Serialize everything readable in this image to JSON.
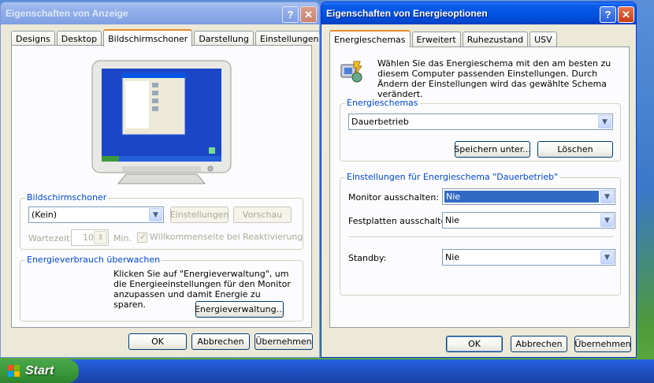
{
  "display_window": {
    "title": "Eigenschaften von Anzeige",
    "help_btn": "?",
    "close_btn": "✕",
    "tabs": [
      "Designs",
      "Desktop",
      "Bildschirmschoner",
      "Darstellung",
      "Einstellungen"
    ],
    "selected_tab": "Bildschirmschoner",
    "screensaver_group": {
      "label": "Bildschirmschoner",
      "selected": "(Kein)",
      "settings_btn": "Einstellungen",
      "preview_btn": "Vorschau",
      "wait_label": "Wartezeit:",
      "wait_value": "10",
      "min_label": "Min.",
      "welcome_label": "Willkommenseite bei Reaktivierung"
    },
    "energy_group": {
      "label": "Energieverbrauch überwachen",
      "description": "Klicken Sie auf \"Energieverwaltung\", um die Energieeinstellungen für den Monitor anzupassen und damit Energie zu sparen.",
      "button": "Energieverwaltung..."
    },
    "footer": {
      "ok": "OK",
      "cancel": "Abbrechen",
      "apply": "Übernehmen"
    }
  },
  "power_window": {
    "title": "Eigenschaften von Energieoptionen",
    "help_btn": "?",
    "close_btn": "✕",
    "tabs": [
      "Energieschemas",
      "Erweitert",
      "Ruhezustand",
      "USV"
    ],
    "selected_tab": "Energieschemas",
    "intro": "Wählen Sie das Energieschema mit den am besten zu diesem Computer passenden Einstellungen. Durch Ändern der Einstellungen wird das gewählte Schema verändert.",
    "schemes_group": {
      "label": "Energieschemas",
      "selected": "Dauerbetrieb",
      "save_btn": "Speichern unter...",
      "delete_btn": "Löschen"
    },
    "settings_group": {
      "label": "Einstellungen für Energieschema \"Dauerbetrieb\"",
      "monitor_label": "Monitor ausschalten:",
      "monitor_value": "Nie",
      "disk_label": "Festplatten ausschalten:",
      "disk_value": "Nie",
      "standby_label": "Standby:",
      "standby_value": "Nie"
    },
    "footer": {
      "ok": "OK",
      "cancel": "Abbrechen",
      "apply": "Übernehmen"
    }
  },
  "taskbar": {
    "start_label": "Start"
  },
  "colors": {
    "title_active": "#0055e5",
    "group_label": "#0046d5",
    "tab_highlight": "#e68b2c",
    "selection": "#316ac5"
  }
}
